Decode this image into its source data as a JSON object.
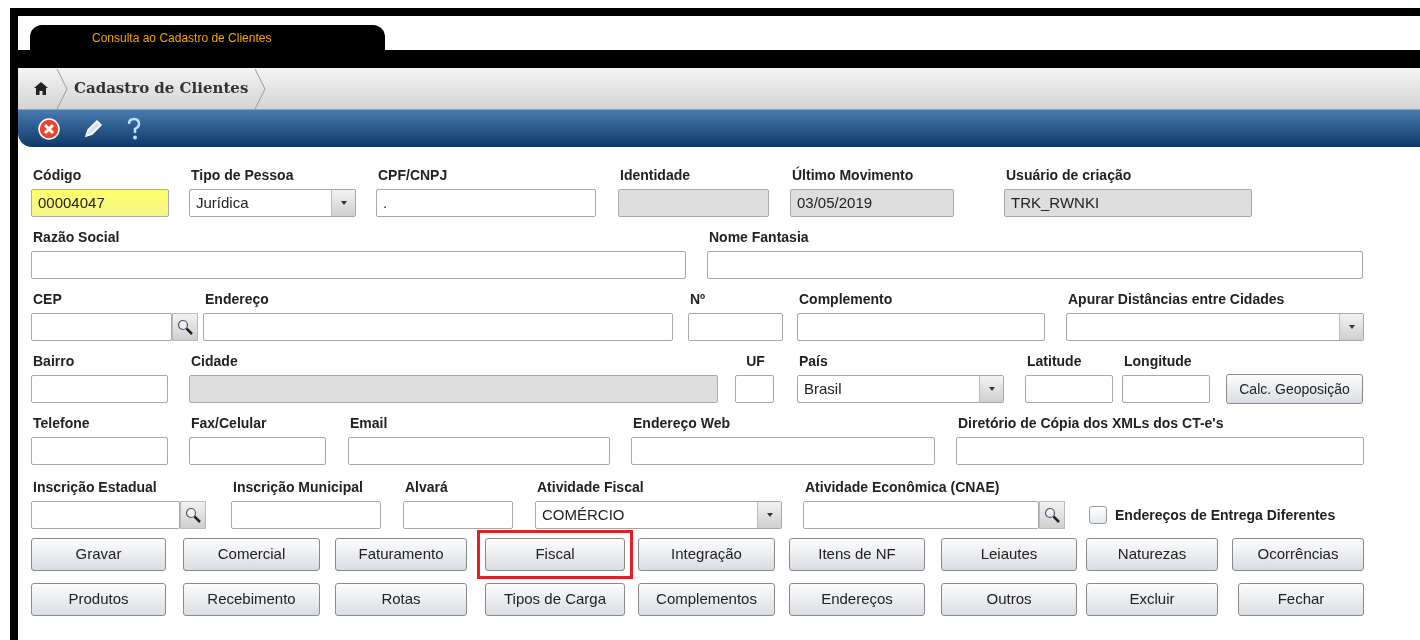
{
  "tab": {
    "label": "Consulta ao Cadastro de Clientes",
    "selected": true
  },
  "breadcrumb": {
    "items": [
      "Cadastro de Clientes"
    ]
  },
  "toolbar": {
    "buttons": [
      {
        "kind": "close"
      },
      {
        "kind": "edit"
      },
      {
        "kind": "help"
      }
    ]
  },
  "form": {
    "rows": [
      [
        {
          "label": "Código",
          "value": "00004047",
          "kind": "text",
          "focused": true
        },
        {
          "label": "Tipo de Pessoa",
          "value": "Jurídica",
          "kind": "select"
        },
        {
          "label": "CPF/CNPJ",
          "value": ".",
          "kind": "text"
        },
        {
          "label": "Identidade",
          "kind": "text",
          "disabled": true
        },
        {
          "label": "Último Movimento",
          "value": "03/05/2019",
          "kind": "text",
          "disabled": true
        },
        {
          "label": "Usuário de criação",
          "value": "TRK_RWNKI",
          "kind": "text",
          "disabled": true
        }
      ],
      [
        {
          "label": "Razão Social",
          "kind": "text"
        },
        {
          "label": "Nome Fantasia",
          "kind": "text"
        }
      ],
      [
        {
          "label": "CEP",
          "kind": "lookup"
        },
        {
          "label": "Endereço",
          "kind": "text"
        },
        {
          "label": "Nº",
          "kind": "text"
        },
        {
          "label": "Complemento",
          "kind": "text"
        },
        {
          "label": "Apurar Distâncias entre Cidades",
          "kind": "select"
        }
      ],
      [
        {
          "label": "Bairro",
          "kind": "text"
        },
        {
          "label": "Cidade",
          "kind": "text",
          "disabled": true
        },
        {
          "label": "UF",
          "kind": "text"
        },
        {
          "label": "País",
          "value": "Brasil",
          "kind": "select"
        },
        {
          "label": "Latitude",
          "kind": "text"
        },
        {
          "label": "Longitude",
          "kind": "text"
        },
        {
          "label": "Calc. Geoposição",
          "kind": "button"
        }
      ],
      [
        {
          "label": "Telefone",
          "kind": "text"
        },
        {
          "label": "Fax/Celular",
          "kind": "text"
        },
        {
          "label": "Email",
          "kind": "text"
        },
        {
          "label": "Endereço Web",
          "kind": "text"
        },
        {
          "label": "Diretório de Cópia dos XMLs dos CT-e's",
          "kind": "text"
        }
      ],
      [
        {
          "label": "Inscrição Estadual",
          "kind": "lookup"
        },
        {
          "label": "Inscrição Municipal",
          "kind": "text"
        },
        {
          "label": "Alvará",
          "kind": "text"
        },
        {
          "label": "Atividade Fiscal",
          "value": "COMÉRCIO",
          "kind": "select"
        },
        {
          "label": "Atividade Econômica (CNAE)",
          "kind": "lookup"
        },
        {
          "label": "Endereços de Entrega Diferentes",
          "kind": "checkbox",
          "checked": false
        }
      ]
    ]
  },
  "buttons": [
    [
      {
        "label": "Gravar",
        "highlighted": false
      },
      {
        "label": "Comercial",
        "highlighted": false
      },
      {
        "label": "Faturamento",
        "highlighted": false
      },
      {
        "label": "Fiscal",
        "highlighted": true
      },
      {
        "label": "Integração",
        "highlighted": false
      },
      {
        "label": "Itens de NF",
        "highlighted": false
      },
      {
        "label": "Leiautes",
        "highlighted": false
      },
      {
        "label": "Naturezas",
        "highlighted": false
      },
      {
        "label": "Ocorrências",
        "highlighted": false
      }
    ],
    [
      {
        "label": "Produtos",
        "highlighted": false
      },
      {
        "label": "Recebimento",
        "highlighted": false
      },
      {
        "label": "Rotas",
        "highlighted": false
      },
      {
        "label": "Tipos de Carga",
        "highlighted": false
      },
      {
        "label": "Complementos",
        "highlighted": false
      },
      {
        "label": "Endereços",
        "highlighted": false
      },
      {
        "label": "Outros",
        "highlighted": false
      },
      {
        "label": "Excluir",
        "highlighted": false
      },
      {
        "label": "Fechar",
        "highlighted": false
      }
    ]
  ]
}
